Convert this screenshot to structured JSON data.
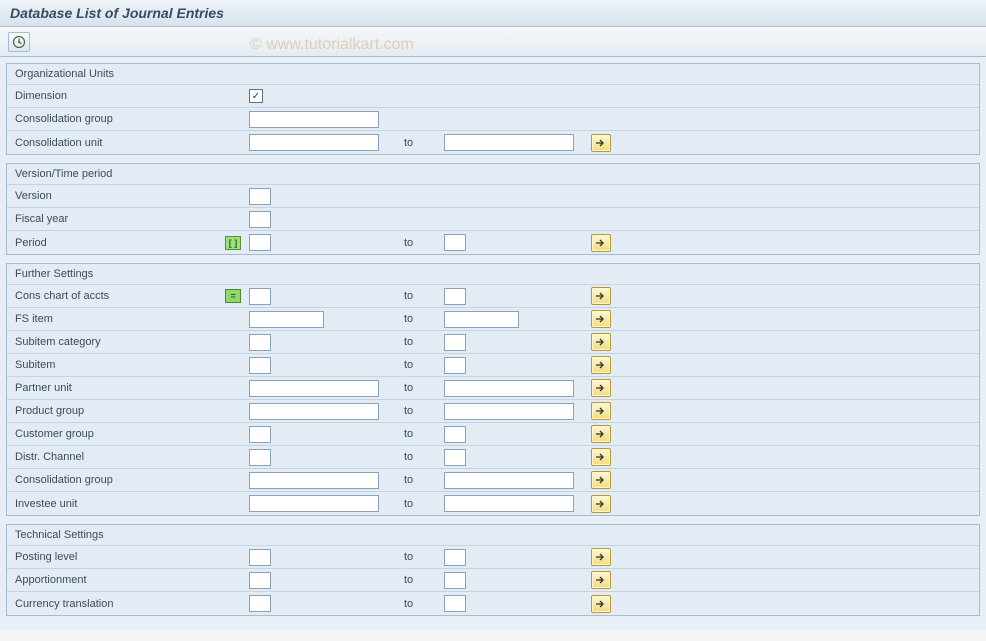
{
  "title": "Database List of Journal Entries",
  "watermark": "© www.tutorialkart.com",
  "groups": {
    "org": {
      "title": "Organizational Units",
      "dimension_label": "Dimension",
      "dimension_checked": "✓",
      "cons_group_label": "Consolidation group",
      "cons_unit_label": "Consolidation unit",
      "to": "to"
    },
    "version": {
      "title": "Version/Time period",
      "version_label": "Version",
      "fiscal_year_label": "Fiscal year",
      "period_label": "Period",
      "period_marker": "[ ]",
      "to": "to"
    },
    "further": {
      "title": "Further Settings",
      "cons_chart_label": "Cons chart of accts",
      "cons_chart_marker": "=",
      "fs_item_label": "FS item",
      "subitem_cat_label": "Subitem category",
      "subitem_label": "Subitem",
      "partner_unit_label": "Partner unit",
      "product_group_label": "Product group",
      "customer_group_label": "Customer group",
      "distr_channel_label": "Distr. Channel",
      "cons_group2_label": "Consolidation group",
      "investee_unit_label": "Investee unit",
      "to": "to"
    },
    "technical": {
      "title": "Technical Settings",
      "posting_level_label": "Posting level",
      "apportionment_label": "Apportionment",
      "currency_trans_label": "Currency translation",
      "to": "to"
    }
  }
}
